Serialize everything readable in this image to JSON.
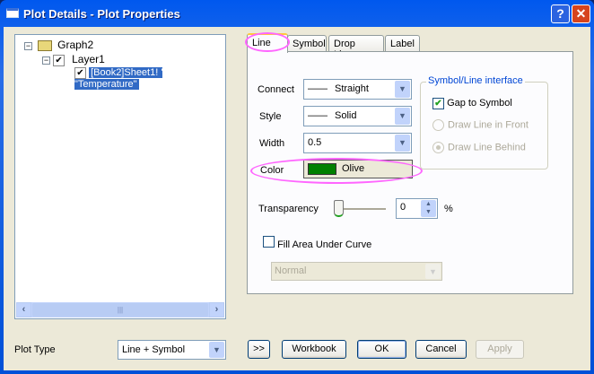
{
  "window": {
    "title": "Plot Details - Plot Properties",
    "help": "?",
    "close": "✕"
  },
  "tree": {
    "root": "Graph2",
    "layer": "Layer1",
    "plot": "[Book2]Sheet1! ' \"Temperature\""
  },
  "tabs": [
    "Line",
    "Symbol",
    "Drop Lines",
    "Label"
  ],
  "line": {
    "connect_label": "Connect",
    "connect_value": "Straight",
    "style_label": "Style",
    "style_value": "Solid",
    "width_label": "Width",
    "width_value": "0.5",
    "color_label": "Color",
    "color_value": "Olive",
    "color_swatch": "#008000",
    "transparency_label": "Transparency",
    "transparency_value": "0",
    "transparency_unit": "%",
    "fill_label": "Fill Area Under Curve",
    "fill_checked": false,
    "fill_mode": "Normal"
  },
  "group": {
    "title": "Symbol/Line interface",
    "gap": "Gap to Symbol",
    "gap_checked": true,
    "front": "Draw Line in Front",
    "behind": "Draw Line Behind",
    "selected": "Draw Line Behind"
  },
  "footer": {
    "plot_type_label": "Plot Type",
    "plot_type_value": "Line + Symbol",
    "expand": ">>",
    "workbook": "Workbook",
    "ok": "OK",
    "cancel": "Cancel",
    "apply": "Apply"
  }
}
